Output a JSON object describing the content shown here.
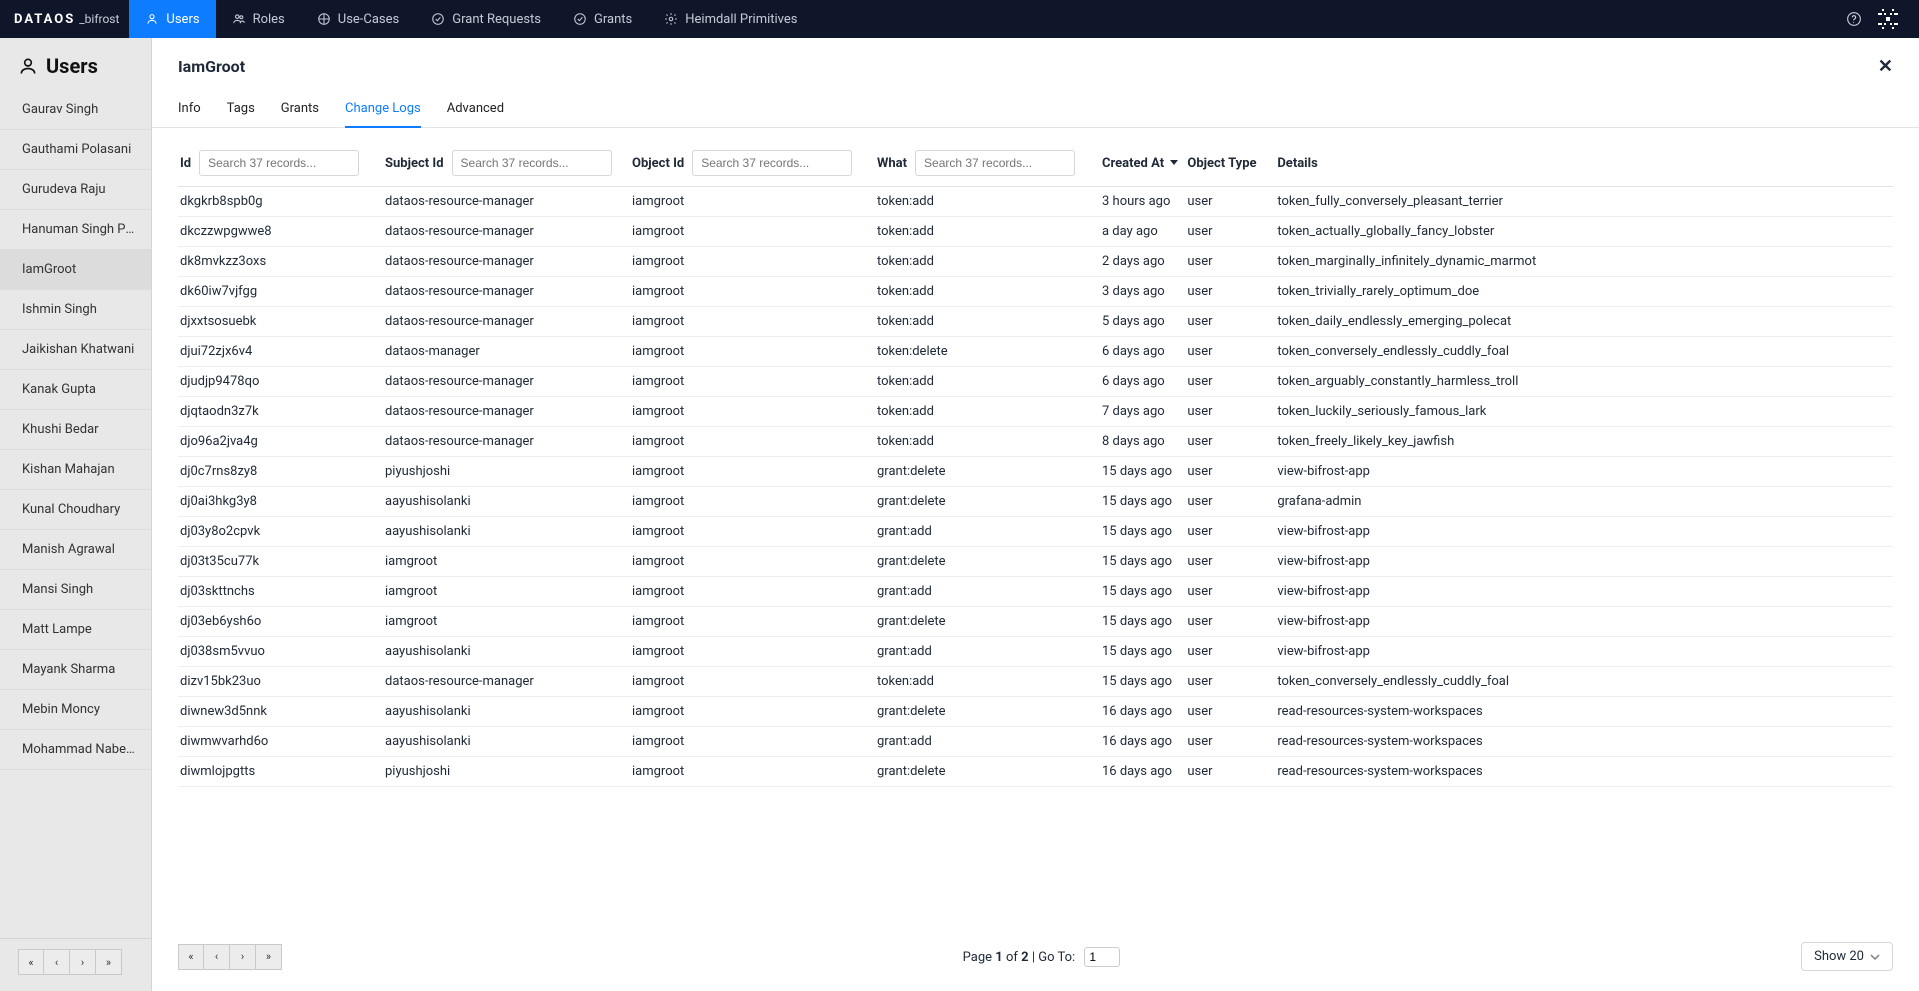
{
  "brand": {
    "name": "DATAOS",
    "sub": "_bifrost"
  },
  "nav": {
    "items": [
      {
        "label": "Users",
        "active": true
      },
      {
        "label": "Roles"
      },
      {
        "label": "Use-Cases"
      },
      {
        "label": "Grant Requests"
      },
      {
        "label": "Grants"
      },
      {
        "label": "Heimdall Primitives"
      }
    ]
  },
  "sidebar": {
    "title": "Users",
    "users": [
      "Gaurav Singh",
      "Gauthami Polasani",
      "Gurudeva Raju",
      "Hanuman Singh Parihar",
      "IamGroot",
      "Ishmin Singh",
      "Jaikishan Khatwani",
      "Kanak Gupta",
      "Khushi Bedar",
      "Kishan Mahajan",
      "Kunal Choudhary",
      "Manish Agrawal",
      "Mansi Singh",
      "Matt Lampe",
      "Mayank Sharma",
      "Mebin Moncy",
      "Mohammad Nabeel Qureshi"
    ],
    "selected": "IamGroot"
  },
  "panel": {
    "title": "IamGroot",
    "tabs": [
      "Info",
      "Tags",
      "Grants",
      "Change Logs",
      "Advanced"
    ],
    "active_tab": "Change Logs"
  },
  "table": {
    "search_placeholder": "Search 37 records...",
    "headers": {
      "id": "Id",
      "subject_id": "Subject Id",
      "object_id": "Object Id",
      "what": "What",
      "created_at": "Created At",
      "object_type": "Object Type",
      "details": "Details"
    },
    "rows": [
      {
        "id": "dkgkrb8spb0g",
        "subject": "dataos-resource-manager",
        "object": "iamgroot",
        "what": "token:add",
        "created": "3 hours ago",
        "type": "user",
        "details": "token_fully_conversely_pleasant_terrier"
      },
      {
        "id": "dkczzwpgwwe8",
        "subject": "dataos-resource-manager",
        "object": "iamgroot",
        "what": "token:add",
        "created": "a day ago",
        "type": "user",
        "details": "token_actually_globally_fancy_lobster"
      },
      {
        "id": "dk8mvkzz3oxs",
        "subject": "dataos-resource-manager",
        "object": "iamgroot",
        "what": "token:add",
        "created": "2 days ago",
        "type": "user",
        "details": "token_marginally_infinitely_dynamic_marmot"
      },
      {
        "id": "dk60iw7vjfgg",
        "subject": "dataos-resource-manager",
        "object": "iamgroot",
        "what": "token:add",
        "created": "3 days ago",
        "type": "user",
        "details": "token_trivially_rarely_optimum_doe"
      },
      {
        "id": "djxxtsosuebk",
        "subject": "dataos-resource-manager",
        "object": "iamgroot",
        "what": "token:add",
        "created": "5 days ago",
        "type": "user",
        "details": "token_daily_endlessly_emerging_polecat"
      },
      {
        "id": "djui72zjx6v4",
        "subject": "dataos-manager",
        "object": "iamgroot",
        "what": "token:delete",
        "created": "6 days ago",
        "type": "user",
        "details": "token_conversely_endlessly_cuddly_foal"
      },
      {
        "id": "djudjp9478qo",
        "subject": "dataos-resource-manager",
        "object": "iamgroot",
        "what": "token:add",
        "created": "6 days ago",
        "type": "user",
        "details": "token_arguably_constantly_harmless_troll"
      },
      {
        "id": "djqtaodn3z7k",
        "subject": "dataos-resource-manager",
        "object": "iamgroot",
        "what": "token:add",
        "created": "7 days ago",
        "type": "user",
        "details": "token_luckily_seriously_famous_lark"
      },
      {
        "id": "djo96a2jva4g",
        "subject": "dataos-resource-manager",
        "object": "iamgroot",
        "what": "token:add",
        "created": "8 days ago",
        "type": "user",
        "details": "token_freely_likely_key_jawfish"
      },
      {
        "id": "dj0c7rns8zy8",
        "subject": "piyushjoshi",
        "object": "iamgroot",
        "what": "grant:delete",
        "created": "15 days ago",
        "type": "user",
        "details": "view-bifrost-app"
      },
      {
        "id": "dj0ai3hkg3y8",
        "subject": "aayushisolanki",
        "object": "iamgroot",
        "what": "grant:delete",
        "created": "15 days ago",
        "type": "user",
        "details": "grafana-admin"
      },
      {
        "id": "dj03y8o2cpvk",
        "subject": "aayushisolanki",
        "object": "iamgroot",
        "what": "grant:add",
        "created": "15 days ago",
        "type": "user",
        "details": "view-bifrost-app"
      },
      {
        "id": "dj03t35cu77k",
        "subject": "iamgroot",
        "object": "iamgroot",
        "what": "grant:delete",
        "created": "15 days ago",
        "type": "user",
        "details": "view-bifrost-app"
      },
      {
        "id": "dj03skttnchs",
        "subject": "iamgroot",
        "object": "iamgroot",
        "what": "grant:add",
        "created": "15 days ago",
        "type": "user",
        "details": "view-bifrost-app"
      },
      {
        "id": "dj03eb6ysh6o",
        "subject": "iamgroot",
        "object": "iamgroot",
        "what": "grant:delete",
        "created": "15 days ago",
        "type": "user",
        "details": "view-bifrost-app"
      },
      {
        "id": "dj038sm5vvuo",
        "subject": "aayushisolanki",
        "object": "iamgroot",
        "what": "grant:add",
        "created": "15 days ago",
        "type": "user",
        "details": "view-bifrost-app"
      },
      {
        "id": "dizv15bk23uo",
        "subject": "dataos-resource-manager",
        "object": "iamgroot",
        "what": "token:add",
        "created": "15 days ago",
        "type": "user",
        "details": "token_conversely_endlessly_cuddly_foal"
      },
      {
        "id": "diwnew3d5nnk",
        "subject": "aayushisolanki",
        "object": "iamgroot",
        "what": "grant:delete",
        "created": "16 days ago",
        "type": "user",
        "details": "read-resources-system-workspaces"
      },
      {
        "id": "diwmwvarhd6o",
        "subject": "aayushisolanki",
        "object": "iamgroot",
        "what": "grant:add",
        "created": "16 days ago",
        "type": "user",
        "details": "read-resources-system-workspaces"
      },
      {
        "id": "diwmlojpgtts",
        "subject": "piyushjoshi",
        "object": "iamgroot",
        "what": "grant:delete",
        "created": "16 days ago",
        "type": "user",
        "details": "read-resources-system-workspaces"
      }
    ]
  },
  "pagination": {
    "page_label_prefix": "Page ",
    "page_current": "1",
    "page_of": " of ",
    "page_total": "2",
    "goto_sep": " | Go To: ",
    "goto_value": "1",
    "show_label": "Show 20"
  }
}
